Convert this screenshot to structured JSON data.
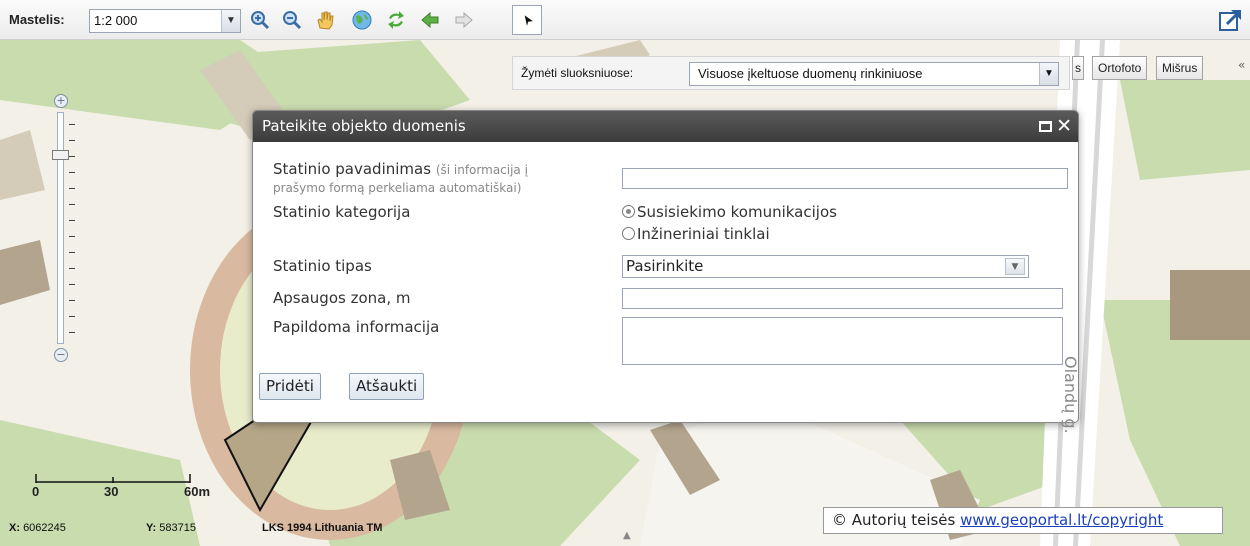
{
  "toolbar": {
    "scale_label": "Mastelis:",
    "scale_value": "1:2 000",
    "tools": [
      "zoom-in-icon",
      "zoom-out-icon",
      "pan-hand-icon",
      "globe-icon",
      "refresh-icon",
      "back-arrow-icon",
      "forward-arrow-icon",
      "pointer-icon"
    ],
    "export_icon": "export-icon"
  },
  "layers": {
    "label": "Žymėti sluoksniuose:",
    "selected": "Visuose įkeltuose duomenų rinkiniuose",
    "buttons": {
      "s": "s",
      "ortofoto": "Ortofoto",
      "misrus": "Mišrus"
    }
  },
  "dialog": {
    "title": "Pateikite objekto duomenis",
    "fields": {
      "name_label": "Statinio pavadinimas",
      "name_hint": "(ši informacija į",
      "name_hint2": "prašymo formą perkeliama automatiškai)",
      "category_label": "Statinio kategorija",
      "category_options": [
        "Susisiekimo komunikacijos",
        "Inžineriniai tinklai"
      ],
      "category_selected": 0,
      "type_label": "Statinio tipas",
      "type_value": "Pasirinkite",
      "zone_label": "Apsaugos zona, m",
      "info_label": "Papildoma informacija"
    },
    "buttons": {
      "add": "Pridėti",
      "cancel": "Atšaukti"
    }
  },
  "scalebar": {
    "ticks": [
      "0",
      "30",
      "60m"
    ]
  },
  "coords": {
    "x_label": "X:",
    "x_value": "6062245",
    "y_label": "Y:",
    "y_value": "583715"
  },
  "crs": "LKS 1994 Lithuania TM",
  "copyright": {
    "text": "© Autorių teisės",
    "link": "www.geoportal.lt/copyright"
  },
  "street": "Olandų g.",
  "colors": {
    "park": "#c9dcae",
    "road": "#ffffff",
    "track": "#d9b9a0",
    "building": "#b3a48d",
    "dialog_title": "#444444"
  }
}
